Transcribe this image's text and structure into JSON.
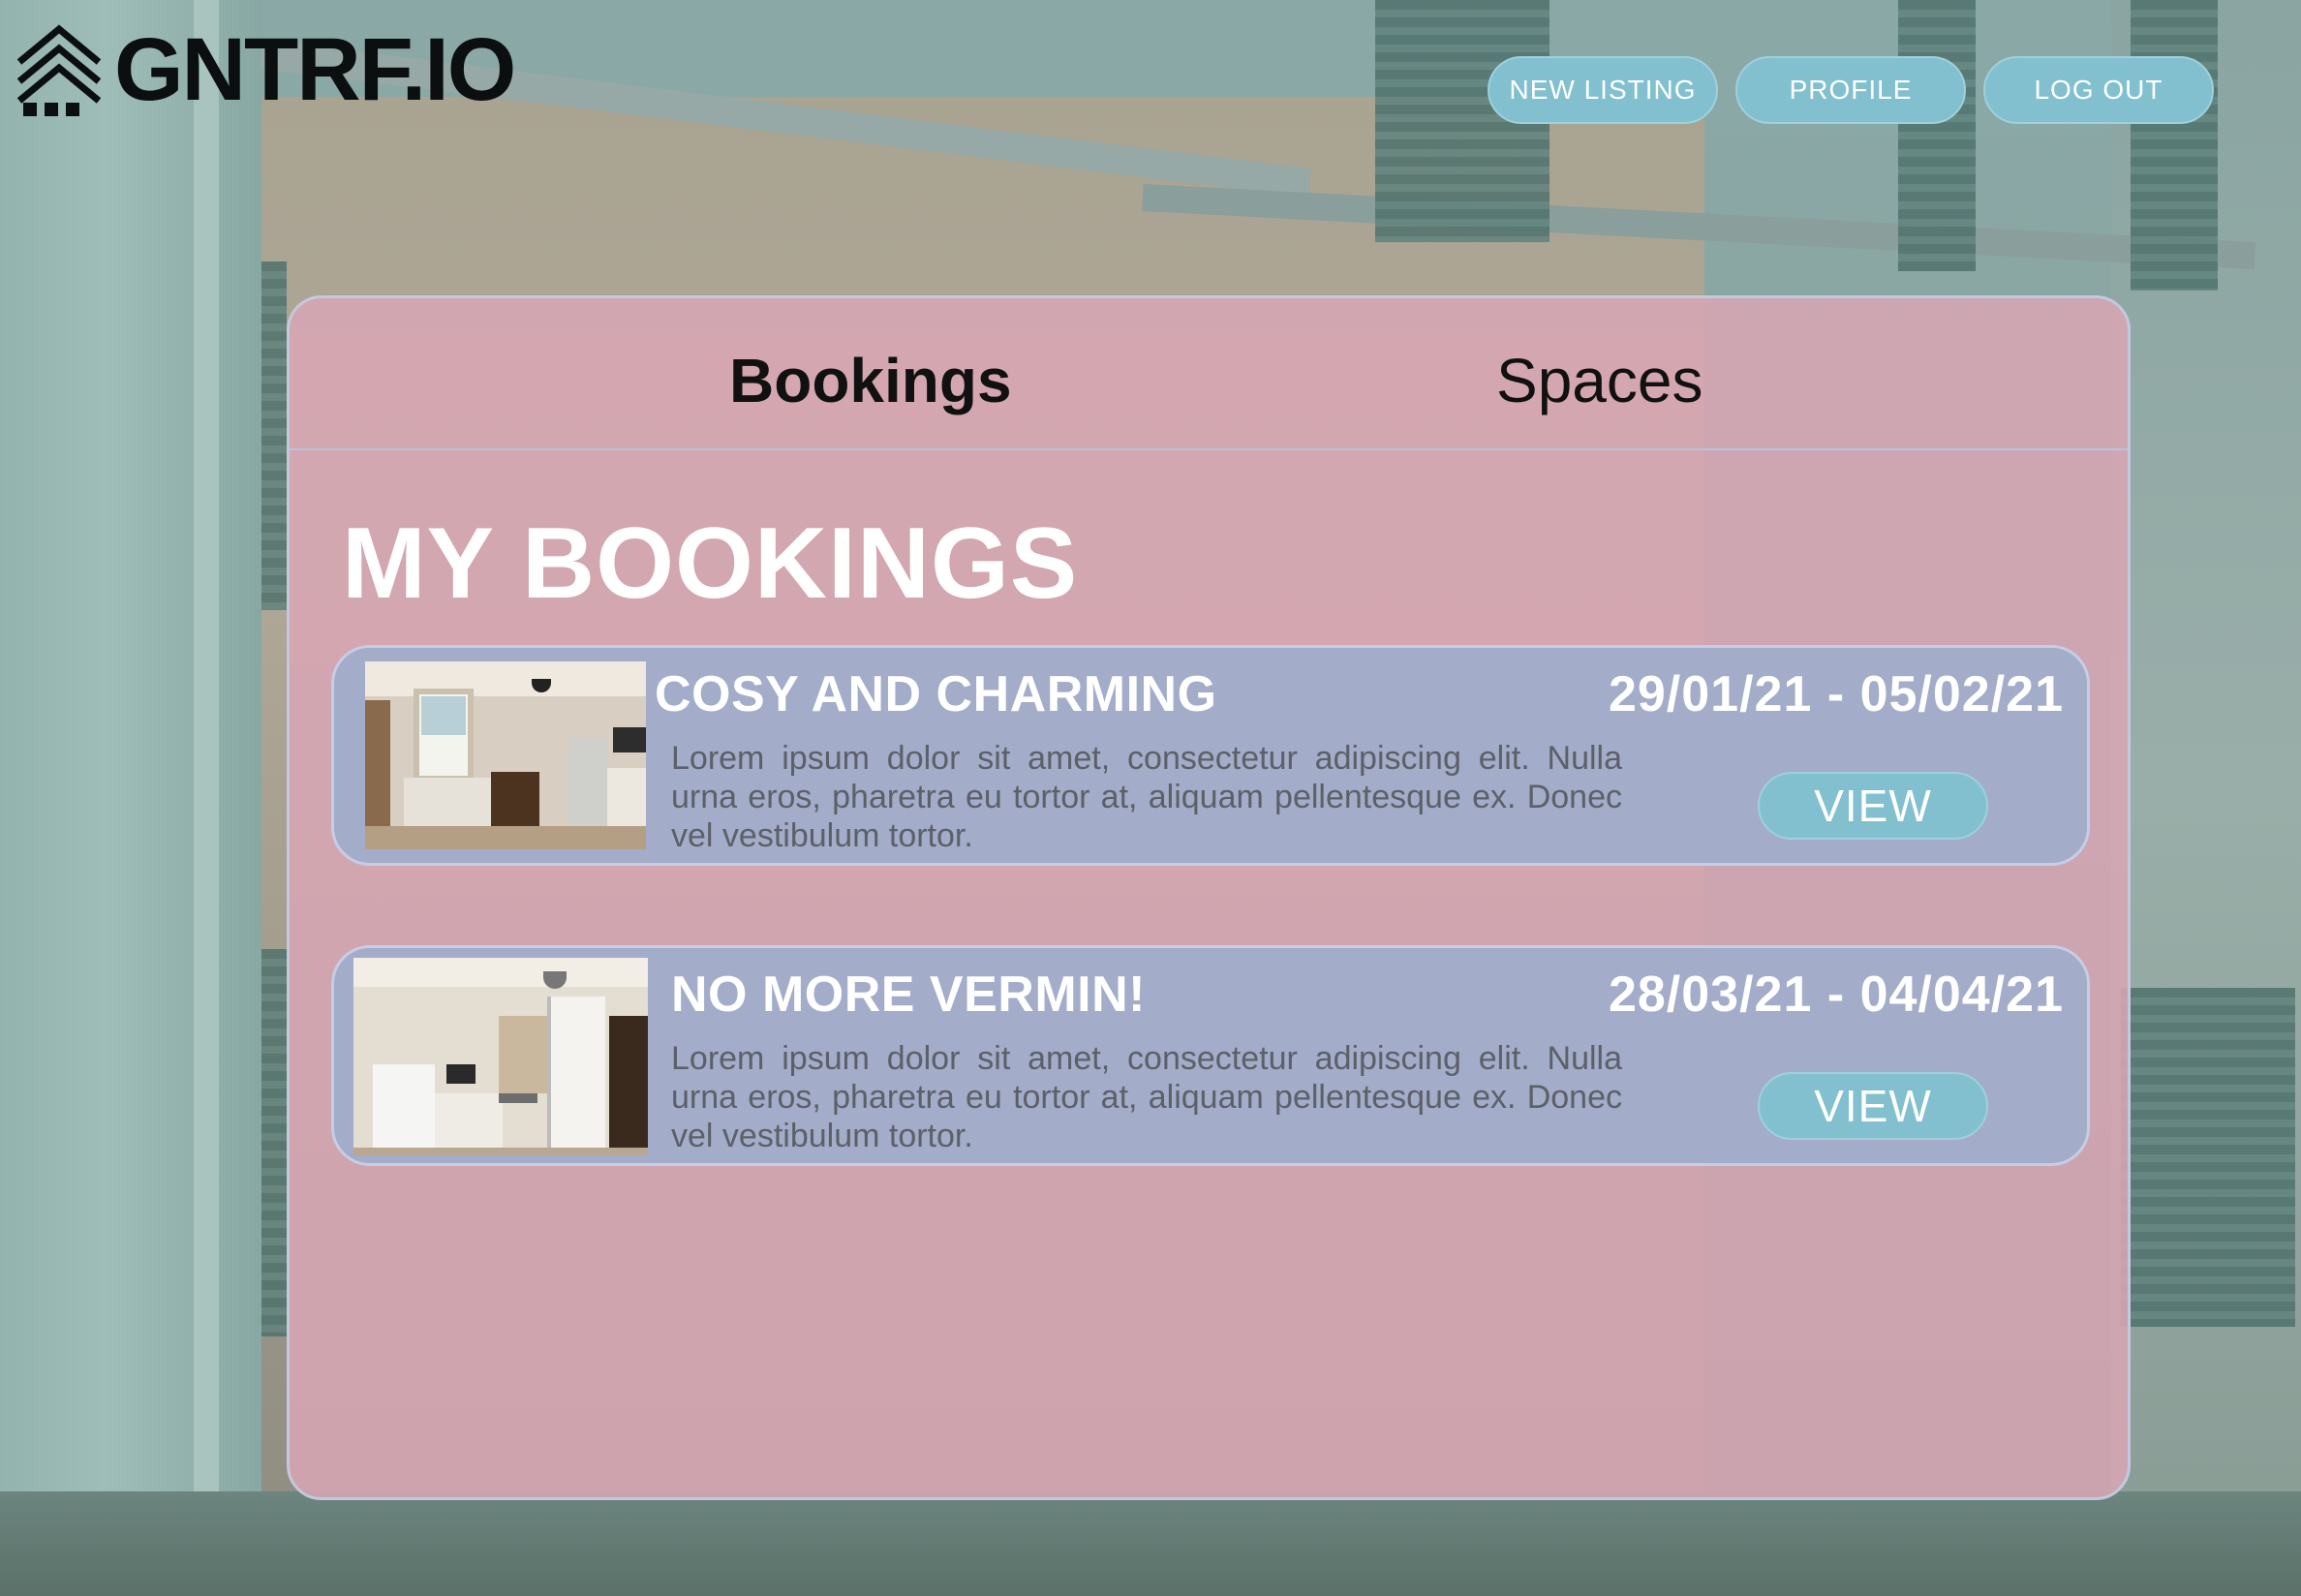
{
  "brand": {
    "name": "GNTRF.IO",
    "logo_icon": "house-stack-icon"
  },
  "nav": {
    "new_listing": "NEW LISTING",
    "profile": "PROFILE",
    "log_out": "LOG OUT"
  },
  "tabs": [
    {
      "label": "Bookings",
      "active": true
    },
    {
      "label": "Spaces",
      "active": false
    }
  ],
  "page_title": "MY BOOKINGS",
  "bookings": [
    {
      "title": "COSY AND CHARMING",
      "dates": "29/01/21 - 05/02/21",
      "description": "Lorem ipsum dolor sit amet, consectetur adipiscing elit. Nulla urna eros, pharetra eu tortor at, aliquam pellentesque ex. Donec vel vestibulum tortor.",
      "button": "VIEW"
    },
    {
      "title": "NO MORE VERMIN!",
      "dates": "28/03/21 - 04/04/21",
      "description": "Lorem ipsum dolor sit amet, consectetur adipiscing elit. Nulla urna eros, pharetra eu tortor at, aliquam pellentesque ex. Donec vel vestibulum tortor.",
      "button": "VIEW"
    }
  ],
  "colors": {
    "accent_button": "#82c0cf",
    "panel": "#d8a6b4",
    "card": "#a3acc8",
    "text_dark": "#111111",
    "text_light": "#ffffff"
  }
}
